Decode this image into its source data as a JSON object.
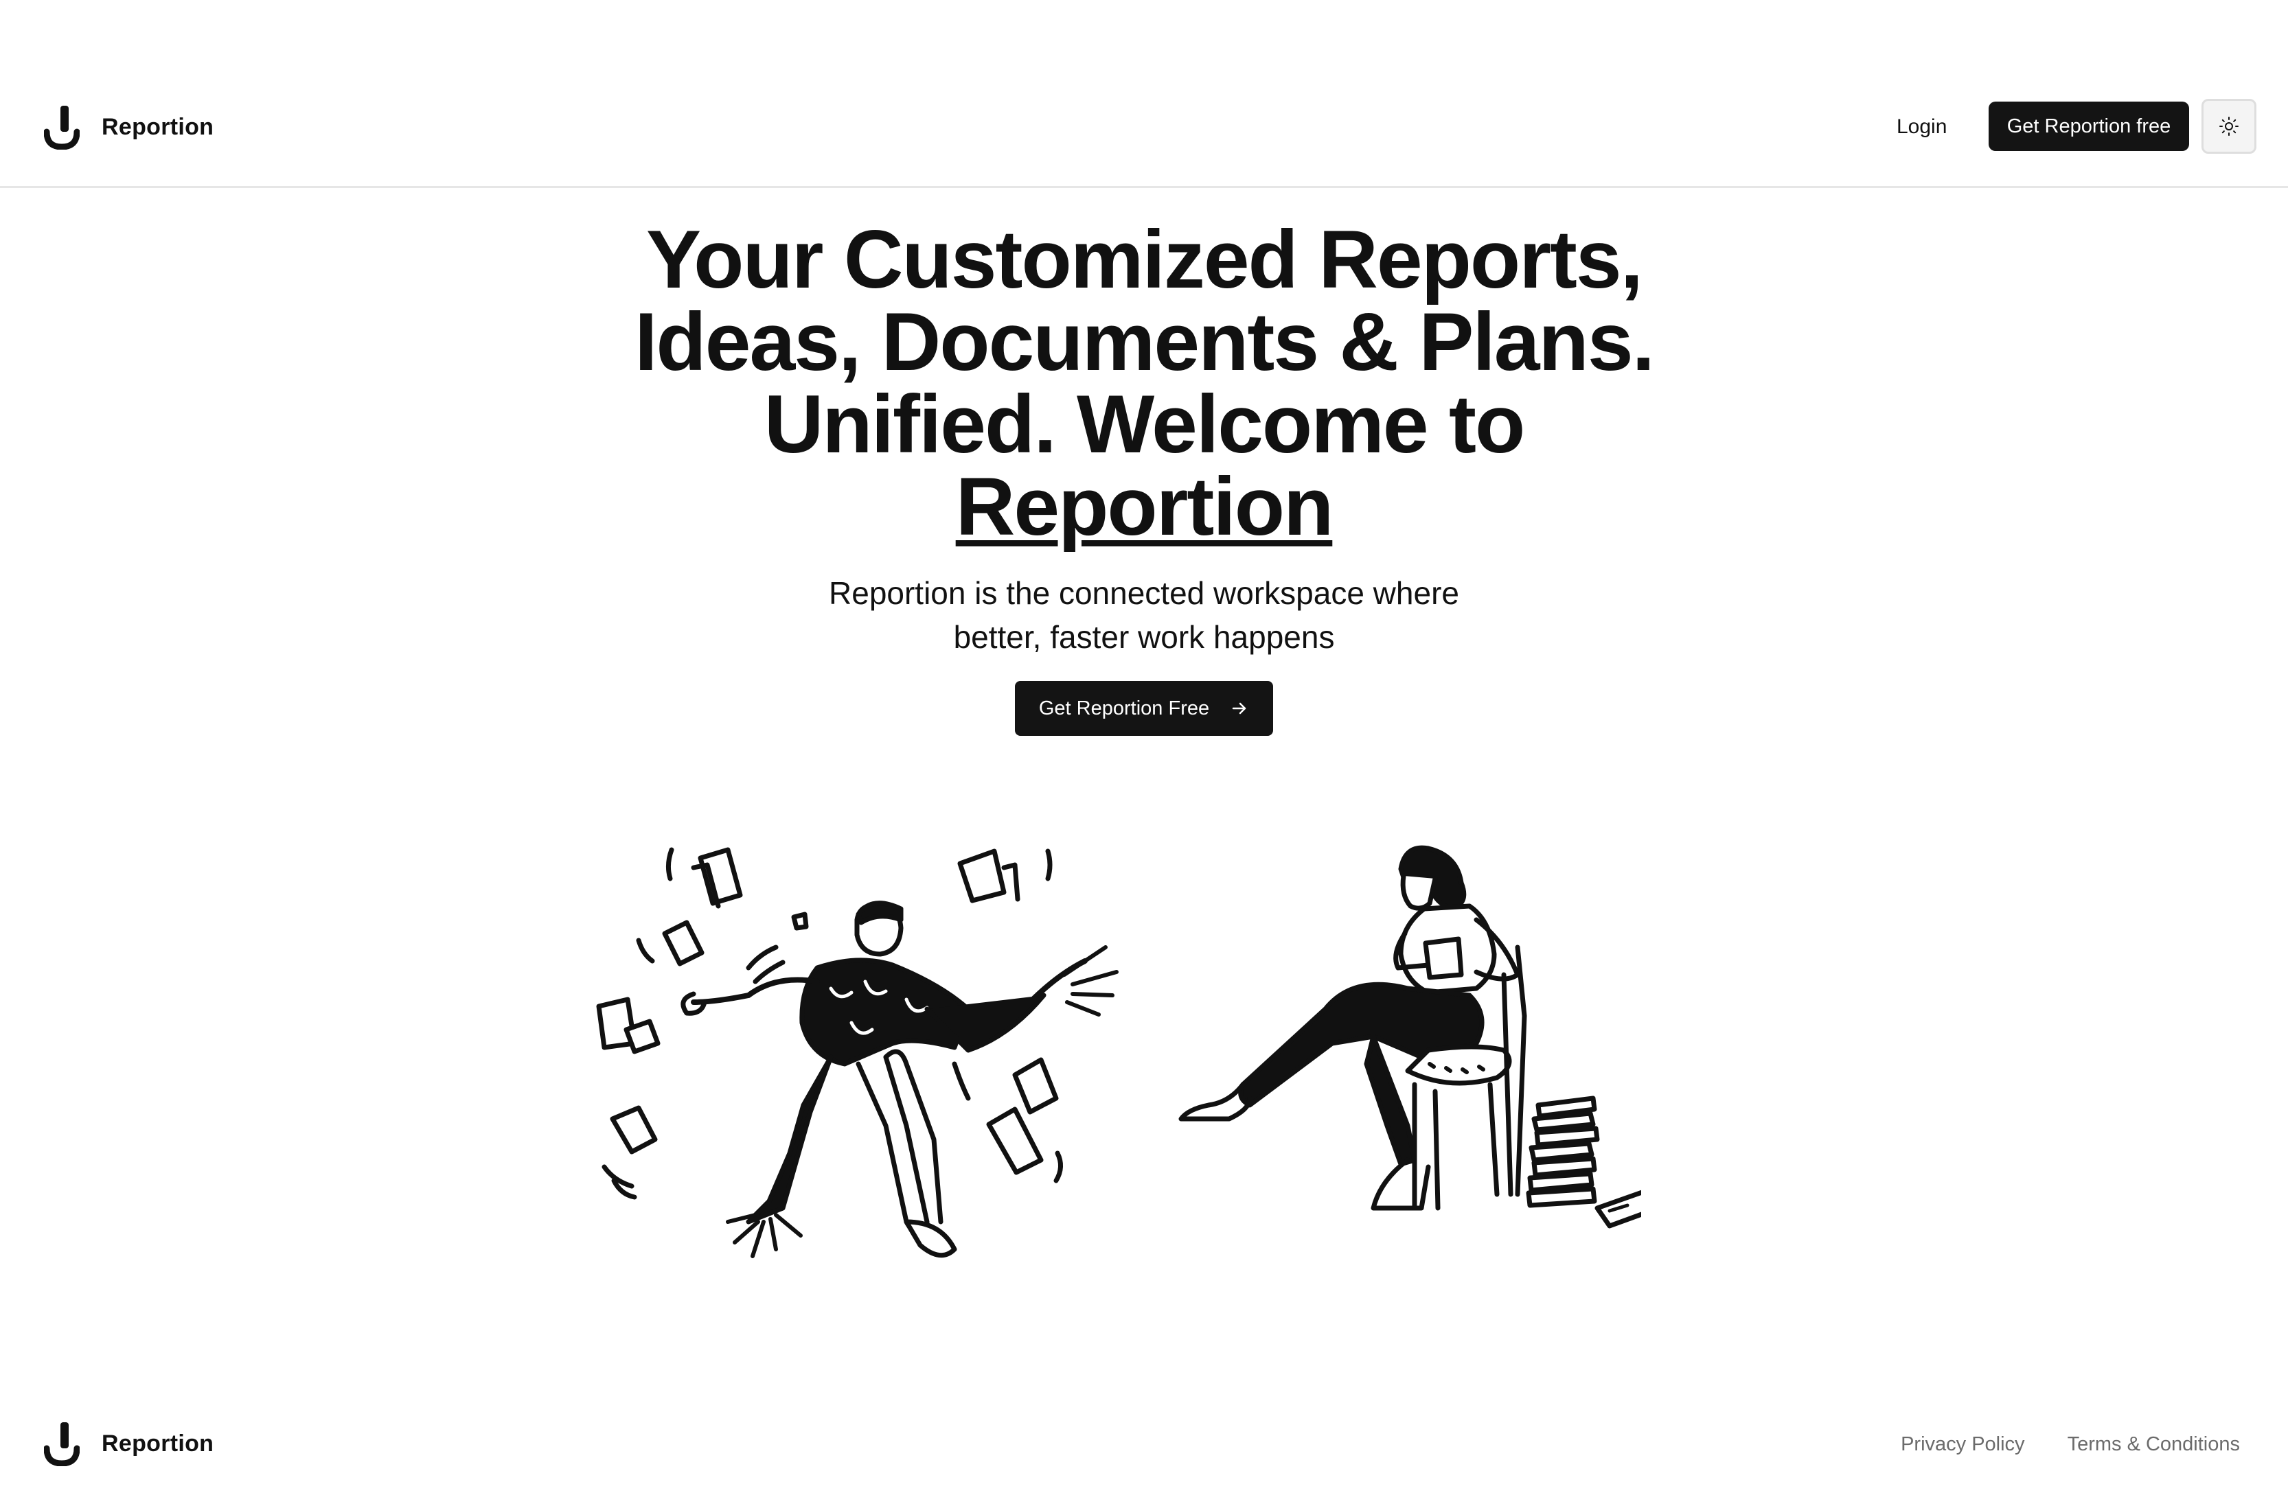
{
  "header": {
    "brand_name": "Reportion",
    "login_label": "Login",
    "cta_label": "Get Reportion free",
    "theme_toggle_icon": "sun-icon"
  },
  "hero": {
    "title_lines": [
      "Your Customized Reports,",
      "Ideas, Documents & Plans.",
      "Unified. Welcome to"
    ],
    "title_brand": "Reportion",
    "subtitle_line1": "Reportion is the connected workspace where",
    "subtitle_line2": "better, faster work happens",
    "cta_label": "Get Reportion Free",
    "cta_icon": "arrow-right-icon"
  },
  "illustration": {
    "icon": "people-working-illustration"
  },
  "footer": {
    "brand_name": "Reportion",
    "links": [
      "Privacy Policy",
      "Terms & Conditions"
    ]
  },
  "colors": {
    "primary": "#141414",
    "background": "#ffffff",
    "muted_text": "#6b6b6b",
    "border": "#e6e6e6"
  }
}
